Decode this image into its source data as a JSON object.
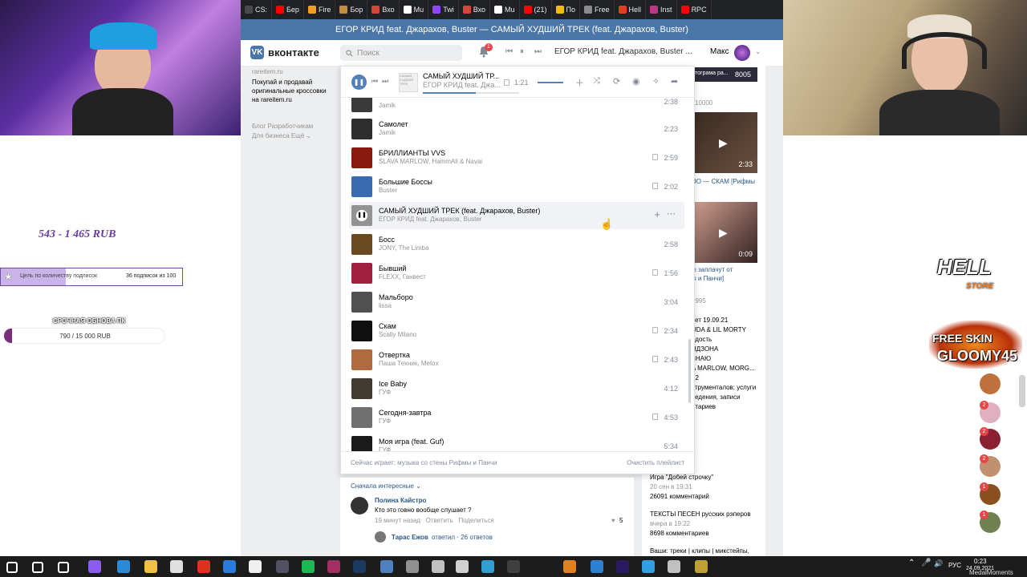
{
  "browser": {
    "tabs": [
      {
        "label": "CS:",
        "icon": "cs-icon",
        "color": "#4a4a4a"
      },
      {
        "label": "Бер",
        "icon": "youtube-icon",
        "color": "#ff0000"
      },
      {
        "label": "Fire",
        "icon": "fire-icon",
        "color": "#f0a020"
      },
      {
        "label": "Бор",
        "icon": "bor-icon",
        "color": "#c09040"
      },
      {
        "label": "Вхо",
        "icon": "gmail-icon",
        "color": "#d44638"
      },
      {
        "label": "Mu",
        "icon": "music-icon",
        "color": "#ffffff"
      },
      {
        "label": "Twi",
        "icon": "twitch-icon",
        "color": "#9146ff"
      },
      {
        "label": "Вхо",
        "icon": "gmail-icon",
        "color": "#d44638"
      },
      {
        "label": "Mu",
        "icon": "music-icon",
        "color": "#ffffff"
      },
      {
        "label": "(21)",
        "icon": "youtube-icon",
        "color": "#ff0000"
      },
      {
        "label": "По",
        "icon": "ds-icon",
        "color": "#f0c000"
      },
      {
        "label": "Free",
        "icon": "free-icon",
        "color": "#8a8a8a"
      },
      {
        "label": "Hell",
        "icon": "hell-icon",
        "color": "#e04020"
      },
      {
        "label": "Inst",
        "icon": "instagram-icon",
        "color": "#c13584"
      },
      {
        "label": "RPC",
        "icon": "youtube-icon",
        "color": "#ff0000"
      }
    ],
    "window_title": "ЕГОР КРИД feat. Джарахов, Buster — САМЫЙ ХУДШИЙ ТРЕК (feat. Джарахов, Buster)"
  },
  "vk_header": {
    "logo": "вконтакте",
    "logo_letter": "VK",
    "search_placeholder": "Поиск",
    "notif_count": "1",
    "now_playing": "ЕГОР КРИД feat. Джарахов, Buster ...",
    "user_name": "Макс",
    "ctrl_prev": "⏮",
    "ctrl_pause": "⏸",
    "ctrl_next": "⏭",
    "chevron": "⌄"
  },
  "left_column": {
    "ad_domain": "rareitem.ru",
    "ad_text": "Покупай и продавай оригинальные кроссовки на rareitem.ru",
    "links_row1": "Блог   Разработчикам",
    "links_row2": "Для бизнеса   Ещё ⌄"
  },
  "player": {
    "current_title": "САМЫЙ ХУДШИЙ ТР...",
    "current_artist": "ЕГОР КРИД feat. Джа...",
    "current_time": "1:21",
    "progress": 0.55,
    "pause_glyph": "❚❚",
    "prev_glyph": "⏮",
    "next_glyph": "⏭",
    "cover_text": "САМЫЙ ХУДШИЙ ТРЕК",
    "tracks": [
      {
        "title": "",
        "artist": "Jamik",
        "duration": "2:38",
        "lyrics": false,
        "cover": "#3a3a3a"
      },
      {
        "title": "Самолет",
        "artist": "Jamik",
        "duration": "2:23",
        "lyrics": false,
        "cover": "#2e2e2e"
      },
      {
        "title": "БРИЛЛИАНТЫ VVS",
        "artist": "SLAVA MARLOW, HammAli & Navai",
        "duration": "2:59",
        "lyrics": true,
        "cover": "#8a1a10"
      },
      {
        "title": "Большие Боссы",
        "artist": "Buster",
        "duration": "2:02",
        "lyrics": true,
        "cover": "#3a6ab0"
      },
      {
        "title": "САМЫЙ ХУДШИЙ ТРЕК (feat. Джарахов, Buster)",
        "artist": "ЕГОР КРИД feat. Джарахов, Buster",
        "duration": "",
        "lyrics": false,
        "cover": "#939393",
        "active": true
      },
      {
        "title": "Босс",
        "artist": "JONY, The Limba",
        "duration": "2:58",
        "lyrics": false,
        "cover": "#6a4a20"
      },
      {
        "title": "Бывший",
        "artist": "FLEXX, Ганвест",
        "duration": "1:56",
        "lyrics": true,
        "cover": "#a02040"
      },
      {
        "title": "Мальборо",
        "artist": "lissa",
        "duration": "3:04",
        "lyrics": false,
        "cover": "#505050"
      },
      {
        "title": "Скам",
        "artist": "Scally Milano",
        "duration": "2:34",
        "lyrics": true,
        "cover": "#101010"
      },
      {
        "title": "Отвертка",
        "artist": "Паша Техник, Metox",
        "duration": "2:43",
        "lyrics": true,
        "cover": "#b06a40"
      },
      {
        "title": "Ice Baby",
        "artist": "ГУФ",
        "duration": "4:12",
        "lyrics": false,
        "cover": "#403a30"
      },
      {
        "title": "Сегодня-завтра",
        "artist": "ГУФ",
        "duration": "4:53",
        "lyrics": true,
        "cover": "#707070"
      },
      {
        "title": "Моя игра (feat. Guf)",
        "artist": "ГУФ",
        "duration": "5:34",
        "lyrics": false,
        "cover": "#1a1a1a"
      }
    ],
    "footer_now_playing": "Сейчас играет: музыка со стены Рифмы и Панчи",
    "footer_clear": "Очистить плейлист",
    "add_glyph": "+",
    "more_glyph": "⋯",
    "cursor_glyph": "☝"
  },
  "comments": {
    "sort_label": "Сначала интересные ⌄",
    "items": [
      {
        "author": "Полина Кайстро",
        "text": "Кто это говно вообще слушает ?",
        "meta": "19 минут назад   Ответить   Поделиться",
        "likes": "5",
        "heart": "♥"
      }
    ],
    "reply": {
      "author": "Тарас Ежов",
      "text": "ответил  ·  26 ответов"
    }
  },
  "right_column": {
    "badge_text": "тограма ра...",
    "badge_count": "8005",
    "views": "10000",
    "video1_duration": "2:33",
    "video1_title": "НО — СКАМ [Рифмы",
    "video2_duration": "0:09",
    "video2_title": "ы заплачут от\nы и Панчи]",
    "count2": "9995",
    "items": [
      "вет 19.09.21",
      "UDA & LIL MORTY",
      "одость",
      "НДЗОНА",
      "ЗНАЮ",
      "A MARLOW, MORG...",
      "12",
      "струменталов; услуги",
      "ведения, записи",
      "нтариев"
    ],
    "post1_title": "Игра \"Добей строчку\"",
    "post1_time": "20 сен в 19:31",
    "post1_comments": "26091 комментарий",
    "post2_title": "ТЕКСТЫ ПЕСЕН русских рэперов",
    "post2_time": "вчера в 19:22",
    "post2_comments": "8698 комментариев",
    "post3_title": "Ваши: треки | клипы | микстейпы,"
  },
  "stream_overlay": {
    "donation_range": "543 - 1 465 RUB",
    "goal_label": "Цель по количеству подписок",
    "goal_count": "36 подписок из 100",
    "goal_progress": 0.36,
    "goal_star": "★",
    "pc_title": "СРОЧНАЯ ОБНОВА ПК",
    "pc_count": "790 / 15 000 RUB",
    "pc_progress": 0.05,
    "hell_logo": "HELL",
    "hell_sub": "STORE",
    "gloomy_top": "FREE SKIN",
    "gloomy_bottom": "GLOOMY45",
    "side_avatars": [
      {
        "badge": "",
        "color": "#c0703a"
      },
      {
        "badge": "2",
        "color": "#e0b0c0"
      },
      {
        "badge": "2",
        "color": "#8a2030"
      },
      {
        "badge": "2",
        "color": "#c09070"
      },
      {
        "badge": "1",
        "color": "#8a5020"
      },
      {
        "badge": "1",
        "color": "#708050"
      }
    ]
  },
  "taskbar": {
    "lang": "РУС",
    "time": "0:23",
    "date": "24.09.2021",
    "watermark": "MedalMoments",
    "icons": [
      {
        "name": "windows-start-icon",
        "color": "#ffffff"
      },
      {
        "name": "search-icon",
        "color": "#ffffff"
      },
      {
        "name": "task-view-icon",
        "color": "#ffffff"
      },
      {
        "name": "app-purple-icon",
        "color": "#8a5cf0"
      },
      {
        "name": "edge-icon",
        "color": "#2a8ad8"
      },
      {
        "name": "explorer-icon",
        "color": "#f0c040"
      },
      {
        "name": "store-icon",
        "color": "#e0e0e0"
      },
      {
        "name": "yandex-icon",
        "color": "#e03020"
      },
      {
        "name": "mail-icon",
        "color": "#2a7ad8"
      },
      {
        "name": "yandex-browser-icon",
        "color": "#f0f0f0"
      },
      {
        "name": "obs-icon",
        "color": "#505060"
      },
      {
        "name": "spotify-icon",
        "color": "#1db954"
      },
      {
        "name": "winrar-icon",
        "color": "#a03060"
      },
      {
        "name": "steam-icon",
        "color": "#1a3a60"
      },
      {
        "name": "app-blue-icon",
        "color": "#5080c0"
      },
      {
        "name": "app-gray-icon",
        "color": "#909090"
      },
      {
        "name": "discord-icon",
        "color": "#c0c0c0"
      },
      {
        "name": "app-white-icon",
        "color": "#d0d0d0"
      },
      {
        "name": "app-cyan-icon",
        "color": "#30a0d0"
      },
      {
        "name": "app-dark-icon",
        "color": "#404040"
      },
      {
        "name": "app-orange-icon",
        "color": "#e08020"
      },
      {
        "name": "video-icon",
        "color": "#3080d0"
      },
      {
        "name": "after-effects-icon",
        "color": "#2a1a60"
      },
      {
        "name": "telegram-icon",
        "color": "#30a0e0"
      },
      {
        "name": "steam-alt-icon",
        "color": "#c0c0c0"
      },
      {
        "name": "app-yellow-icon",
        "color": "#c0a030"
      }
    ]
  },
  "colors": {
    "vk_blue": "#4a76a8",
    "vk_accent": "#5181b8",
    "notif_red": "#e64646"
  }
}
